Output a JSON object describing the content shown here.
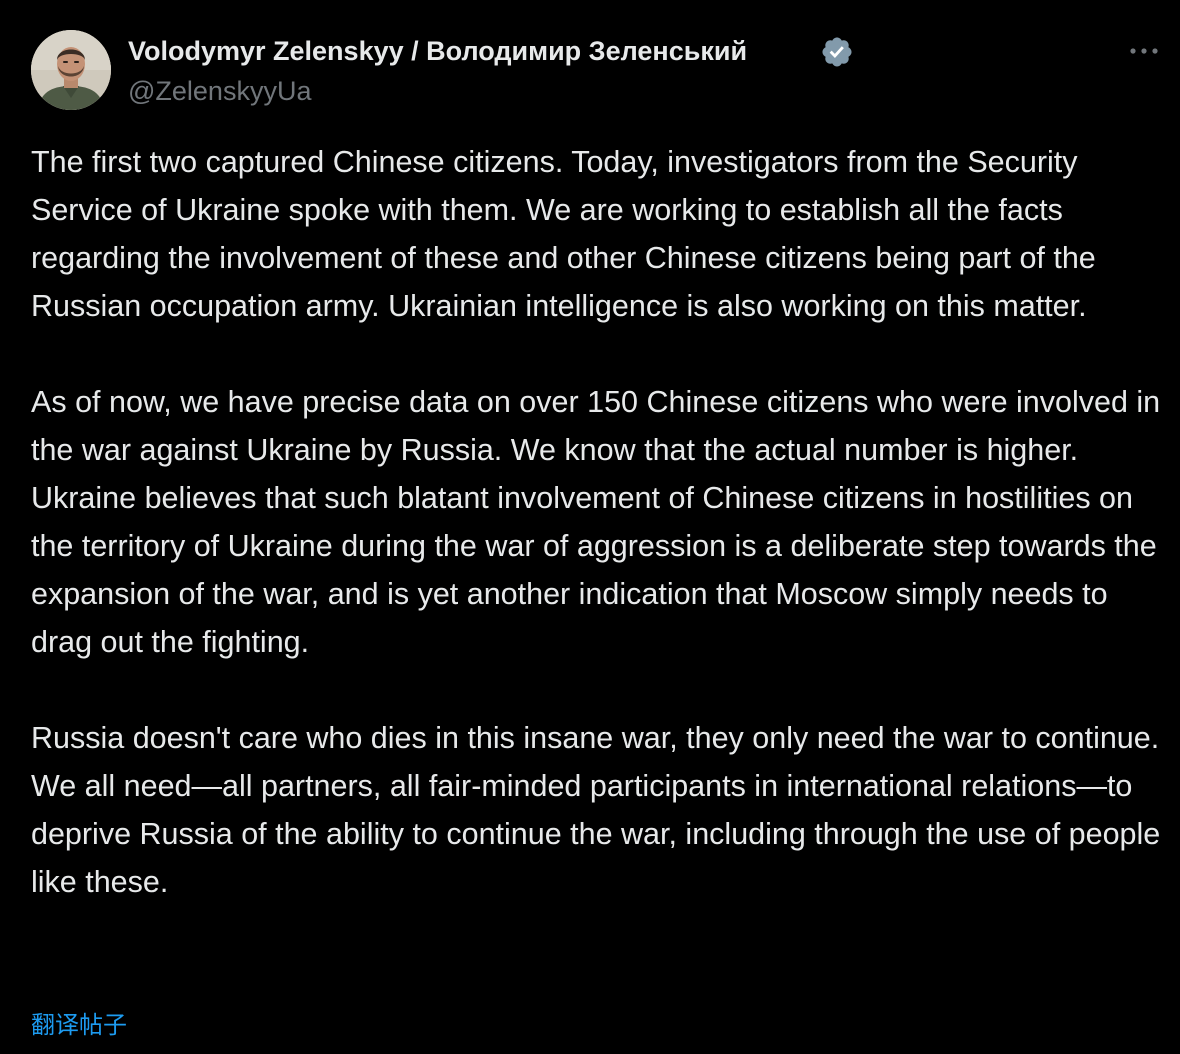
{
  "author": {
    "display_name": "Volodymyr Zelenskyy / Володимир Зеленський",
    "handle": "@ZelenskyyUa",
    "verified": true
  },
  "tweet": {
    "paragraphs": [
      "The first two captured Chinese citizens. Today, investigators from the Security Service of Ukraine spoke with them. We are working to establish all the facts regarding the involvement of these and other Chinese citizens being part of the Russian occupation army. Ukrainian intelligence is also working on this matter.",
      "As of now, we have precise data on over 150 Chinese citizens who were involved in the war against Ukraine by Russia. We know that the actual number is higher. Ukraine believes that such blatant involvement of Chinese citizens in hostilities on the territory of Ukraine during the war of aggression is a deliberate step towards the expansion of the war, and is yet another indication that Moscow simply needs to drag out the fighting.",
      "Russia doesn't care who dies in this insane war, they only need the war to continue. We all need—all partners, all fair-minded participants in international relations—to deprive Russia of the ability to continue the war, including through the use of people like these."
    ],
    "translate_label": "翻译帖子"
  },
  "icons": {
    "verified": "verified-badge-icon",
    "more": "more-horizontal-icon"
  },
  "colors": {
    "background": "#000000",
    "text_primary": "#e7e9ea",
    "text_secondary": "#71767b",
    "link": "#1d9bf0",
    "verified_badge": "#829aab"
  }
}
